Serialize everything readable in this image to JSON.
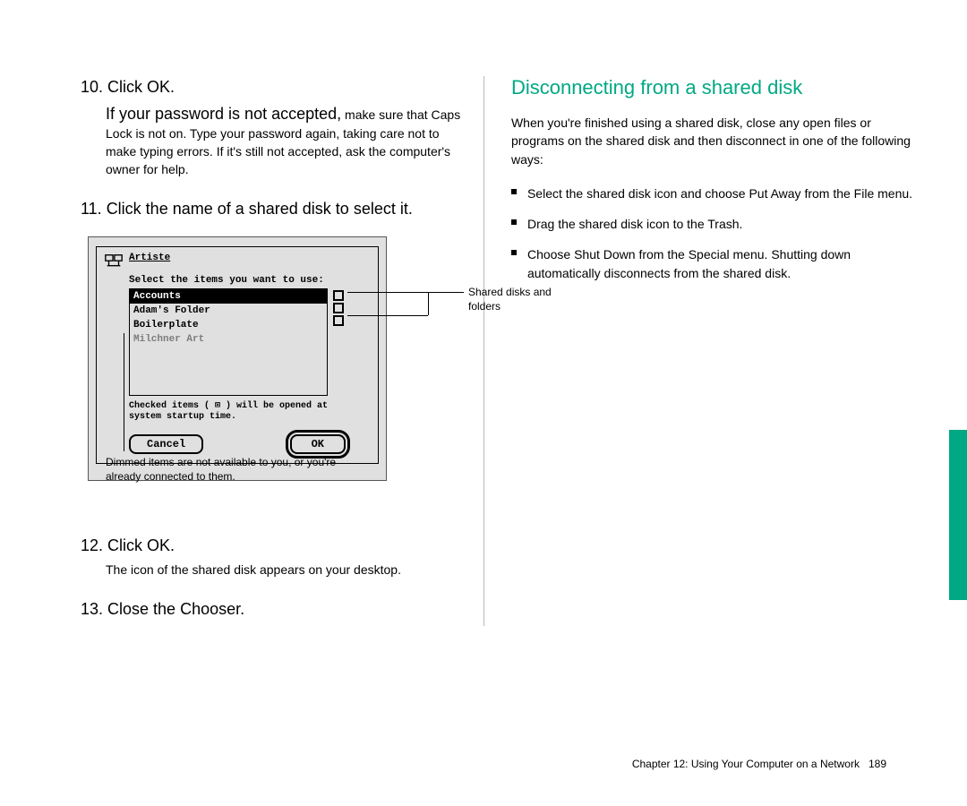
{
  "left": {
    "step10": "10. Click OK.",
    "step10_note_a": "If your password is not accepted,",
    "step10_note_b": "make sure that Caps Lock is not on. Type your password again, taking care not to make typing errors. If it's still not accepted, ask the computer's owner for help.",
    "step11": "11. Click the name of a shared disk to select it.",
    "figure": {
      "server_name": "Artiste",
      "instruction": "Select the items you want to use:",
      "items": [
        {
          "label": "Accounts",
          "selected": true,
          "dimmed": false
        },
        {
          "label": "Adam's Folder",
          "selected": false,
          "dimmed": false
        },
        {
          "label": "Boilerplate",
          "selected": false,
          "dimmed": false
        },
        {
          "label": "Milchner Art",
          "selected": false,
          "dimmed": true
        }
      ],
      "note_line1": "Checked items ( ⊠ ) will be opened at",
      "note_line2": "system startup time.",
      "cancel_label": "Cancel",
      "ok_label": "OK"
    },
    "callout_right": "Shared disks and folders",
    "callout_bottom": "Dimmed items are not available to you, or you're already connected to them.",
    "step12": "12. Click OK.",
    "step12_note": "The icon of the shared disk appears on your desktop.",
    "step13": "13. Close the Chooser."
  },
  "right": {
    "heading": "Disconnecting from a shared disk",
    "intro": "When you're finished using a shared disk, close any open files or programs on the shared disk and then disconnect in one of the following ways:",
    "bullets": [
      "Select the shared disk icon and choose Put Away from the File menu.",
      "Drag the shared disk icon to the Trash.",
      "Choose Shut Down from the Special menu. Shutting down automatically disconnects from the shared disk."
    ]
  },
  "footer": {
    "chapter": "Chapter 12: Using Your Computer on a Network",
    "page": "189"
  }
}
